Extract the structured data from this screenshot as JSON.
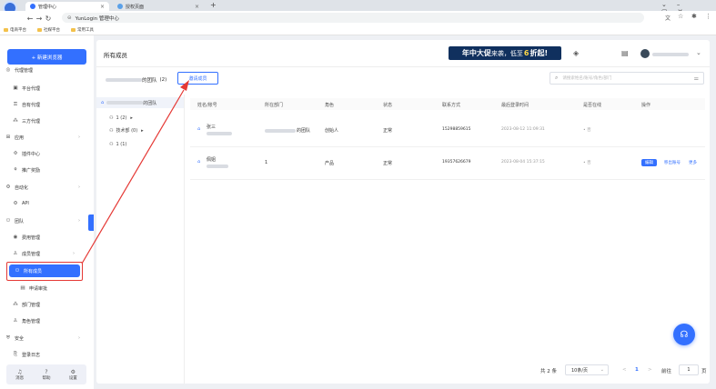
{
  "browser": {
    "tabs": [
      {
        "title": "管理中心"
      },
      {
        "title": "授权页面"
      }
    ],
    "new_tab": "+",
    "url": "YunLogin 管理中心",
    "bookmarks": [
      "电商平台",
      "社媒平台",
      "常用工具"
    ]
  },
  "sidebar": {
    "new_browser": "+ 新建浏览器",
    "items": [
      {
        "label": "代理管理",
        "icon": "globe-icon",
        "type": "group"
      },
      {
        "label": "平台代理",
        "icon": "server-icon",
        "type": "item"
      },
      {
        "label": "自有代理",
        "icon": "key-icon",
        "type": "item"
      },
      {
        "label": "三方代理",
        "icon": "nodes-icon",
        "type": "item"
      },
      {
        "label": "应用",
        "icon": "grid-icon",
        "type": "group"
      },
      {
        "label": "插件中心",
        "icon": "puzzle-icon",
        "type": "item"
      },
      {
        "label": "推广奖励",
        "icon": "gift-icon",
        "type": "item"
      },
      {
        "label": "自动化",
        "icon": "robot-icon",
        "type": "group"
      },
      {
        "label": "API",
        "icon": "api-icon",
        "type": "item"
      },
      {
        "label": "团队",
        "icon": "team-icon",
        "type": "group"
      },
      {
        "label": "费用管理",
        "icon": "coin-icon",
        "type": "item"
      },
      {
        "label": "成员管理",
        "icon": "user-icon",
        "type": "subgroup"
      },
      {
        "label": "所有成员",
        "icon": "users-icon",
        "type": "item",
        "selected": true
      },
      {
        "label": "申请审批",
        "icon": "doc-icon",
        "type": "item"
      },
      {
        "label": "部门管理",
        "icon": "org-icon",
        "type": "item"
      },
      {
        "label": "角色管理",
        "icon": "role-icon",
        "type": "item"
      },
      {
        "label": "安全",
        "icon": "shield-icon",
        "type": "group"
      },
      {
        "label": "登录日志",
        "icon": "log-icon",
        "type": "item"
      }
    ],
    "bottom": [
      {
        "label": "消息",
        "icon": "bell-icon"
      },
      {
        "label": "帮助",
        "icon": "help-icon"
      },
      {
        "label": "设置",
        "icon": "settings-icon"
      }
    ]
  },
  "header": {
    "title": "所有成员",
    "promo_a": "年中大促",
    "promo_b": "来袭，低至",
    "promo_c": "6",
    "promo_d": "折起!"
  },
  "toolbar": {
    "team_suffix": "的团队",
    "team_count": "(2)",
    "invite_button": "邀请成员",
    "search_placeholder": "请搜索姓名/账号/角色/部门"
  },
  "tree": {
    "root": "的团队",
    "nodes": [
      {
        "label": "1 (2)"
      },
      {
        "label": "技术部 (0)"
      },
      {
        "label": "1 (1)"
      }
    ]
  },
  "table": {
    "columns": [
      "姓名/账号",
      "所在部门",
      "角色",
      "状态",
      "联系方式",
      "最后登录时间",
      "是否在线",
      "操作"
    ],
    "rows": [
      {
        "name": "张三",
        "dept": "的团队",
        "role": "创始人",
        "status": "正常",
        "phone": "15298859615",
        "last_login": "2023-08-12 11:09:31",
        "online": "• 否",
        "actions": []
      },
      {
        "name": "佩姐",
        "dept": "1",
        "role": "产品",
        "status": "正常",
        "phone": "19357626679",
        "last_login": "2023-08-04 15:37:15",
        "online": "• 否",
        "actions": [
          "编辑",
          "移出账号",
          "更多"
        ]
      }
    ]
  },
  "pagination": {
    "total": "共 2 条",
    "page_size": "10条/页",
    "prev": "<",
    "current": "1",
    "next": ">",
    "goto": "前往",
    "page_input": "1",
    "page_unit": "页"
  }
}
